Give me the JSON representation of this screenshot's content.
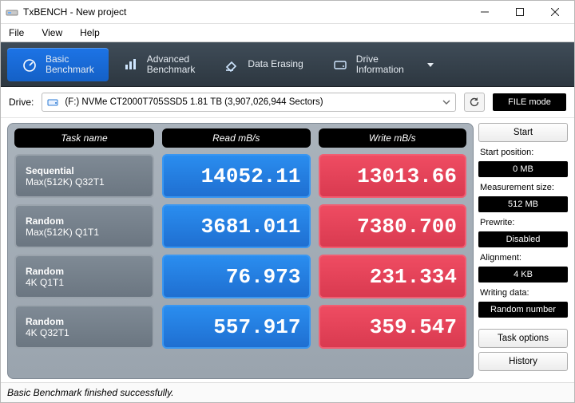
{
  "window": {
    "title": "TxBENCH - New project"
  },
  "menu": {
    "file": "File",
    "view": "View",
    "help": "Help"
  },
  "toolbar": {
    "basic": {
      "l1": "Basic",
      "l2": "Benchmark"
    },
    "advanced": {
      "l1": "Advanced",
      "l2": "Benchmark"
    },
    "erase": {
      "l1": "Data Erasing"
    },
    "drive": {
      "l1": "Drive",
      "l2": "Information"
    }
  },
  "drivebar": {
    "label": "Drive:",
    "value": "(F:) NVMe CT2000T705SSD5   1.81 TB (3,907,026,944 Sectors)",
    "filemode": "FILE mode"
  },
  "headers": {
    "task": "Task name",
    "read": "Read mB/s",
    "write": "Write mB/s"
  },
  "rows": [
    {
      "t1": "Sequential",
      "t2": "Max(512K) Q32T1",
      "read": "14052.11",
      "write": "13013.66"
    },
    {
      "t1": "Random",
      "t2": "Max(512K) Q1T1",
      "read": "3681.011",
      "write": "7380.700"
    },
    {
      "t1": "Random",
      "t2": "4K Q1T1",
      "read": "76.973",
      "write": "231.334"
    },
    {
      "t1": "Random",
      "t2": "4K Q32T1",
      "read": "557.917",
      "write": "359.547"
    }
  ],
  "side": {
    "start": "Start",
    "startpos_label": "Start position:",
    "startpos_value": "0 MB",
    "msize_label": "Measurement size:",
    "msize_value": "512 MB",
    "prewrite_label": "Prewrite:",
    "prewrite_value": "Disabled",
    "align_label": "Alignment:",
    "align_value": "4 KB",
    "wdata_label": "Writing data:",
    "wdata_value": "Random number",
    "taskopt": "Task options",
    "history": "History"
  },
  "status": "Basic Benchmark finished successfully."
}
